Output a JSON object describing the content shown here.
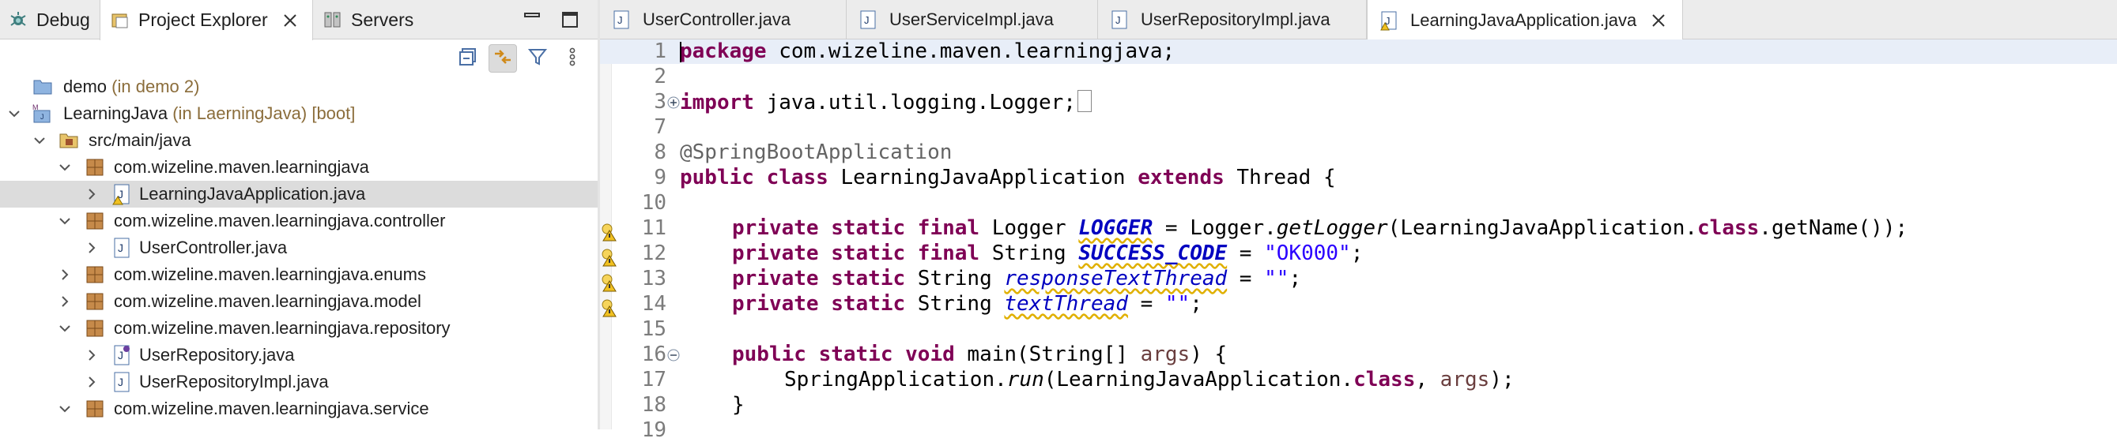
{
  "left_panel": {
    "tabs": [
      {
        "label": "Debug",
        "icon": "debug-icon"
      },
      {
        "label": "Project Explorer",
        "icon": "project-explorer-icon"
      },
      {
        "label": "Servers",
        "icon": "servers-icon"
      }
    ],
    "tree": [
      {
        "label": "demo",
        "decoration": "(in demo 2)"
      },
      {
        "label": "LearningJava",
        "decoration": "(in LaerningJava) [boot]"
      },
      {
        "label": "src/main/java"
      },
      {
        "label": "com.wizeline.maven.learningjava"
      },
      {
        "label": "LearningJavaApplication.java"
      },
      {
        "label": "com.wizeline.maven.learningjava.controller"
      },
      {
        "label": "UserController.java"
      },
      {
        "label": "com.wizeline.maven.learningjava.enums"
      },
      {
        "label": "com.wizeline.maven.learningjava.model"
      },
      {
        "label": "com.wizeline.maven.learningjava.repository"
      },
      {
        "label": "UserRepository.java"
      },
      {
        "label": "UserRepositoryImpl.java"
      },
      {
        "label": "com.wizeline.maven.learningjava.service"
      }
    ]
  },
  "editor": {
    "tabs": [
      {
        "label": "UserController.java"
      },
      {
        "label": "UserServiceImpl.java"
      },
      {
        "label": "UserRepositoryImpl.java"
      },
      {
        "label": "LearningJavaApplication.java"
      }
    ],
    "line_numbers": [
      "1",
      "2",
      "3",
      "7",
      "8",
      "9",
      "10",
      "11",
      "12",
      "13",
      "14",
      "15",
      "16",
      "17",
      "18",
      "19"
    ],
    "code": {
      "l1_kw": "package",
      "l1_rest": " com.wizeline.maven.learningjava;",
      "l3_kw": "import",
      "l3_rest": " java.util.logging.Logger;",
      "l8": "@SpringBootApplication",
      "l9_kw1": "public class",
      "l9_mid": " LearningJavaApplication ",
      "l9_kw2": "extends",
      "l9_rest": " Thread {",
      "l11_kw": "private static final",
      "l11_type": " Logger ",
      "l11_field": "LOGGER",
      "l11_eq": " = Logger.",
      "l11_method": "getLogger",
      "l11_args": "(LearningJavaApplication.",
      "l11_class": "class",
      "l11_end": ".getName());",
      "l12_kw": "private static final",
      "l12_type": " String ",
      "l12_field": "SUCCESS_CODE",
      "l12_eq": " = ",
      "l12_str": "\"OK000\"",
      "l12_end": ";",
      "l13_kw": "private static",
      "l13_type": " String ",
      "l13_field": "responseTextThread",
      "l13_eq": " = ",
      "l13_str": "\"\"",
      "l13_end": ";",
      "l14_kw": "private static",
      "l14_type": " String ",
      "l14_field": "textThread",
      "l14_eq": " = ",
      "l14_str": "\"\"",
      "l14_end": ";",
      "l16_kw": "public static void",
      "l16_mid": " main(String[] ",
      "l16_param": "args",
      "l16_end": ") {",
      "l17_pre": "SpringApplication.",
      "l17_method": "run",
      "l17_args": "(LearningJavaApplication.",
      "l17_class": "class",
      "l17_comma": ", ",
      "l17_param": "args",
      "l17_end": ");",
      "l18": "}"
    }
  }
}
